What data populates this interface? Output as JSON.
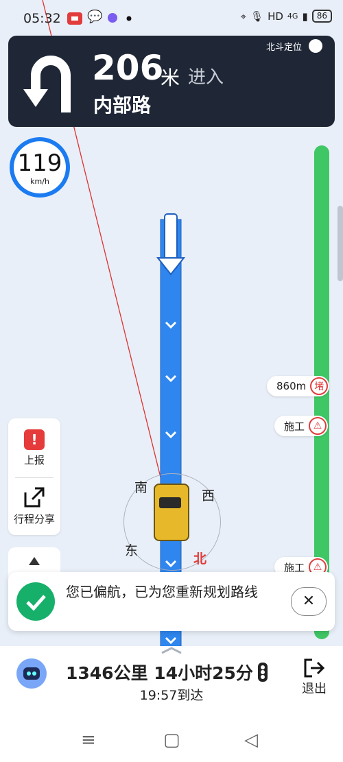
{
  "status": {
    "time": "05:32",
    "hd": "HD",
    "net": "4G",
    "battery": "86"
  },
  "nav": {
    "distance": "206",
    "unit": "米",
    "action": "进入",
    "road": "内部路",
    "beidou": "北斗定位"
  },
  "speed": {
    "value": "119",
    "unit": "km/h"
  },
  "incidents": [
    {
      "text": "860m",
      "badge": "堵"
    },
    {
      "text": "施工",
      "badge": "⚠"
    },
    {
      "text": "施工",
      "badge": "⚠"
    }
  ],
  "tools": {
    "report": "上报",
    "share": "行程分享"
  },
  "compass": {
    "south": "南",
    "west": "西",
    "east": "东",
    "north": "北"
  },
  "toast": {
    "message": "您已偏航，已为您重新规划路线",
    "close": "✕"
  },
  "bottom": {
    "summary": "1346公里 14小时25分",
    "eta": "19:57到达",
    "exit": "退出"
  },
  "colors": {
    "route": "#2f86ee",
    "route_bar": "#3fc765",
    "accent_red": "#e23b3b",
    "nav_card": "#1f2737"
  }
}
